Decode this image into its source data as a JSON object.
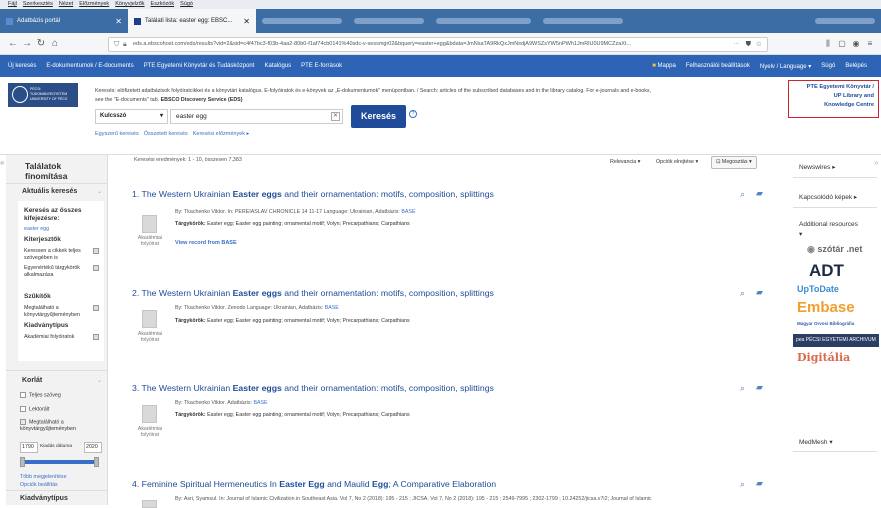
{
  "browser": {
    "menu": [
      "Fájl",
      "Szerkesztés",
      "Nézet",
      "Előzmények",
      "Könyvjelzők",
      "Eszközök",
      "Súgó"
    ],
    "tabs": [
      {
        "label": "Adatbázis portál",
        "close": "✕"
      },
      {
        "label": "Találati lista: easter egg: EBSC...",
        "close": "✕"
      }
    ],
    "url": "eds.a.ebscohost.com/eds/results?vid=2&sid=c4f47bc3-f03b-4aa2-80b0-f1af74cb0141%40sdc-v-sessmgr02&bquery=easter+egg&bdata=JmNsaTA9RkQxJmNsdjA9WSZsYW5nPWh1JmRlU0U9MCZzaXt...",
    "url_extra": "···",
    "nav_glyphs": {
      "back": "←",
      "forward": "→",
      "reload": "↻",
      "home": "⌂"
    }
  },
  "site_nav": {
    "left": [
      "Új keresés",
      "E-dokumentumok / E-documents",
      "PTE Egyetemi Könyvtár és Tudásközpont",
      "Katalógus",
      "PTE E-források"
    ],
    "right": [
      "Mappa",
      "Felhasználói beállítások",
      "Nyelv / Language ▾",
      "Súgó",
      "Belépés"
    ]
  },
  "header": {
    "logo_text": "PÉCSI TUDOMÁNYEGYETEM UNIVERSITY OF PÉCS",
    "notice_line1": "Keresés: elöfizetett adatbázisok folyóiratcikkei és a könyvtári katalógus. E-folyóiratok és e-könyvek az „E-dokumentumok\" menüpontban. / Search: articles of the subscribed databases and in the library catalog. For e-journals and e-books,",
    "notice_line2_prefix": "see the \"E-documents\" tab.",
    "notice_line2_bold": "EBSCO Discovery Service (EDS)",
    "pte_box_lines": [
      "PTE Egyetemi Könyvtár /",
      "UP Library and",
      "Knowledge Centre"
    ]
  },
  "search": {
    "select_value": "Kulcsszó",
    "query": "easter egg",
    "clear": "✕",
    "button": "Keresés",
    "help": "?",
    "sublinks": [
      "Egyszerű keresés",
      "Összetett keresés",
      "Keresési előzmények ▸"
    ]
  },
  "left": {
    "title_line1": "Találatok",
    "title_line2": "finomítása",
    "collapse": "«",
    "current_title": "Aktuális keresés",
    "search_all_label": "Keresés az összes kifejezésre:",
    "search_all_value": "easter egg",
    "expanders_title": "Kiterjesztők",
    "expander1": "Keressen a cikkek teljes szövegében is",
    "expander2": "Egyenértékű tárgykörök alkalmazása",
    "narrow_title": "Szűkítők",
    "narrow1": "Megtalálható a könyvtárgyűjteményben",
    "pubtype_title": "Kiadványtípus",
    "pubtype1": "Akadémiai folyóiratok",
    "limit_title": "Korlát",
    "limit1": "Teljes szöveg",
    "limit2": "Lektorált",
    "limit3": "Megtalálható a könyvtárgyűjteményben",
    "date_from": "1790",
    "date_label": "Kiadás dátuma",
    "date_to": "2020",
    "more": "Több megjelenítése",
    "options": "Opciók beállítás",
    "kiad_next": "Kiadványtípus"
  },
  "results": {
    "count_text": "Keresési eredmények: 1 - 10, összesen 7,383",
    "relevance": "Relevancia ▾",
    "page_options": "Opciók elrejtése ▾",
    "share": "⊡ Megosztás ▾",
    "items": [
      {
        "num": "1.",
        "pre": "The Western Ukrainian ",
        "b1": "Easter eggs",
        "post": " and their ornamentation: motifs, composition, splittings",
        "meta": "By: Tkachenko Viktor. In: PEREIASLAV CHRONICLE 14 11-17 Language: Ukrainian, Adatbázis:",
        "db": "BASE",
        "subj_label": "Tárgykörök:",
        "subj": "Easter egg; Easter egg painting; ornamental motif; Volyn; Precarpathians; Carpathians",
        "type": "Akadémiai folyóirat",
        "link": "View record from BASE"
      },
      {
        "num": "2.",
        "pre": "The Western Ukrainian ",
        "b1": "Easter eggs",
        "post": " and their ornamentation: motifs, composition, splittings",
        "meta": "By: Tkachenko Viktor. Zenodo Language: Ukrainian, Adatbázis:",
        "db": "BASE",
        "subj_label": "Tárgykörök:",
        "subj": "Easter egg; Easter egg painting; ornamental motif; Volyn; Precarpathians; Carpathians",
        "type": "Akadémiai folyóirat",
        "link": ""
      },
      {
        "num": "3.",
        "pre": "The Western Ukrainian ",
        "b1": "Easter eggs",
        "post": " and their ornamentation: motifs, composition, splittings",
        "meta": "By: Tkachenko Viktor. Adatbázis:",
        "db": "BASE",
        "subj_label": "Tárgykörök:",
        "subj": "Easter egg; Easter egg painting; ornamental motif; Volyn; Precarpathians; Carpathians",
        "type": "Akadémiai folyóirat",
        "link": ""
      },
      {
        "num": "4.",
        "pre": "Feminine Spiritual Hermeneutics In ",
        "b1": "Easter Egg",
        "post": " and Maulid ",
        "b2": "Egg",
        "post2": "; A Comparative Elaboration",
        "meta": "By: Asri, Syamsul. In: Journal of Islamic Civilization in Southeast Asia. Vol 7, No 2 (2018): 195 - 215 ; JICSA. Vol 7, No 2 (2018): 195 - 215 ; 2549-7995 ; 2302-1799 ; 10.24252/jicsa.v7i2; Journal of Islamic",
        "db": "",
        "subj_label": "",
        "subj": "",
        "type": "",
        "link": ""
      }
    ]
  },
  "right": {
    "collapse": "»",
    "newswires": "Newswires ▸",
    "images": "Kapcsolódó képek ▸",
    "additional": "Additional resources",
    "additional_caret": "▾",
    "brands": [
      "szótár .net",
      "ADT",
      "UpToDate",
      "Embase",
      "Magyar Orvosi Bibliográfia",
      "pea PÉCSI EGYETEMI ARCHIVUM",
      "Digitália"
    ],
    "medmesh": "MedMesh ▾"
  }
}
